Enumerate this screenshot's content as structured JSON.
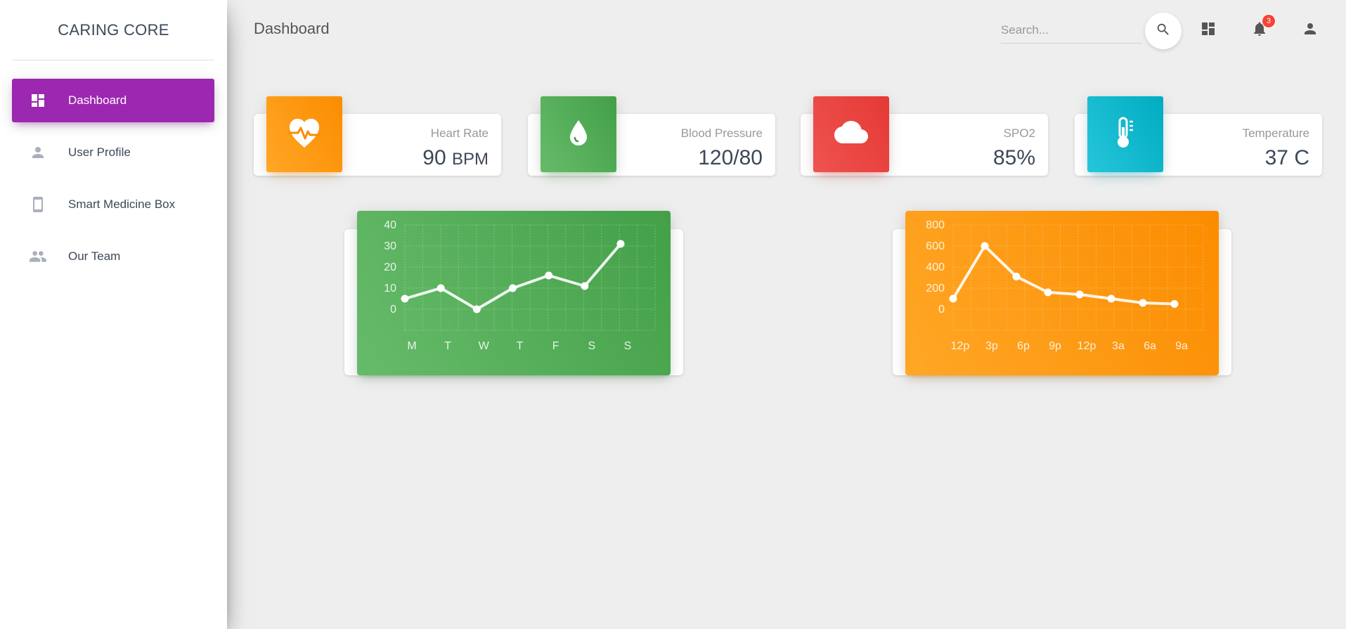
{
  "app": {
    "brand": "CARING CORE"
  },
  "sidebar": {
    "items": [
      {
        "label": "Dashboard",
        "icon": "dashboard-icon",
        "active": true
      },
      {
        "label": "User Profile",
        "icon": "person-icon",
        "active": false
      },
      {
        "label": "Smart Medicine Box",
        "icon": "smartphone-icon",
        "active": false
      },
      {
        "label": "Our Team",
        "icon": "group-icon",
        "active": false
      }
    ]
  },
  "header": {
    "title": "Dashboard",
    "search_placeholder": "Search...",
    "notification_count": "3",
    "icons": [
      "search-icon",
      "dashboard-icon",
      "bell-icon",
      "person-icon"
    ]
  },
  "stats": [
    {
      "label": "Heart Rate",
      "value": "90",
      "unit": "BPM",
      "icon": "heart-pulse-icon",
      "color": "#fb8c00"
    },
    {
      "label": "Blood Pressure",
      "value": "120/80",
      "unit": "",
      "icon": "water-drop-icon",
      "color": "#43a047"
    },
    {
      "label": "SPO2",
      "value": "85%",
      "unit": "",
      "icon": "cloud-icon",
      "color": "#e53935"
    },
    {
      "label": "Temperature",
      "value": "37 C",
      "unit": "",
      "icon": "thermometer-icon",
      "color": "#00acc1"
    }
  ],
  "colors": {
    "accent": "#9c27b0",
    "background": "#eeeeee"
  },
  "chart_data": [
    {
      "type": "line",
      "categories": [
        "M",
        "T",
        "W",
        "T",
        "F",
        "S",
        "S"
      ],
      "values": [
        5,
        10,
        0,
        10,
        16,
        11,
        31
      ],
      "yticks": [
        0,
        10,
        20,
        30,
        40
      ],
      "ylim": [
        0,
        40
      ],
      "grid": true,
      "color": "#43a047"
    },
    {
      "type": "line",
      "categories": [
        "12p",
        "3p",
        "6p",
        "9p",
        "12p",
        "3a",
        "6a",
        "9a"
      ],
      "values": [
        100,
        600,
        310,
        160,
        140,
        100,
        60,
        50
      ],
      "yticks": [
        0,
        200,
        400,
        600,
        800
      ],
      "ylim": [
        0,
        800
      ],
      "grid": true,
      "color": "#fb8c00"
    }
  ]
}
